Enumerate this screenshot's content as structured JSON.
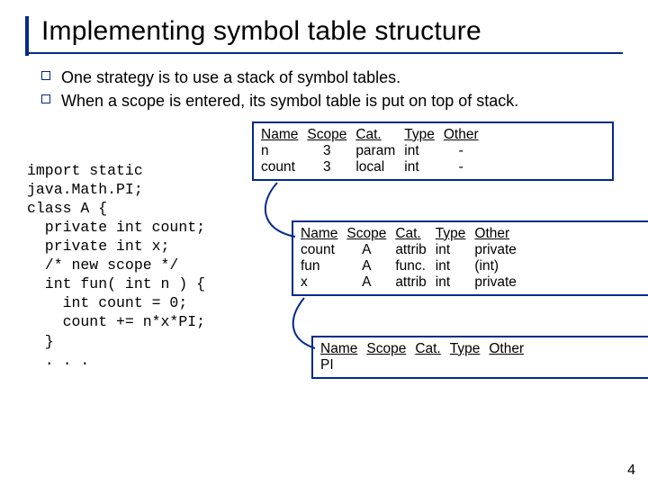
{
  "title": "Implementing symbol table structure",
  "bullets": {
    "b1": "One strategy is to use a stack of symbol tables.",
    "b2": "When a scope is entered, its symbol table is put on top of stack."
  },
  "code": "import static\njava.Math.PI;\nclass A {\n  private int count;\n  private int x;\n  /* new scope */\n  int fun( int n ) {\n    int count = 0;\n    count += n*x*PI;\n  }\n  . . .",
  "headers": {
    "name": "Name",
    "scope": "Scope",
    "cat": "Cat.",
    "type": "Type",
    "other": "Other"
  },
  "dash": "-",
  "t1": {
    "r1": {
      "name": "n",
      "scope": "3",
      "cat": "param",
      "type": "int"
    },
    "r2": {
      "name": "count",
      "scope": "3",
      "cat": "local",
      "type": "int"
    }
  },
  "t2": {
    "r1": {
      "name": "count",
      "scope": "A",
      "cat": "attrib",
      "type": "int",
      "other": "private"
    },
    "r2": {
      "name": "fun",
      "scope": "A",
      "cat": "func.",
      "type": "int",
      "other": "(int)"
    },
    "r3": {
      "name": "x",
      "scope": "A",
      "cat": "attrib",
      "type": "int",
      "other": "private"
    }
  },
  "t3": {
    "r1": {
      "name": "PI"
    }
  },
  "page": "4"
}
